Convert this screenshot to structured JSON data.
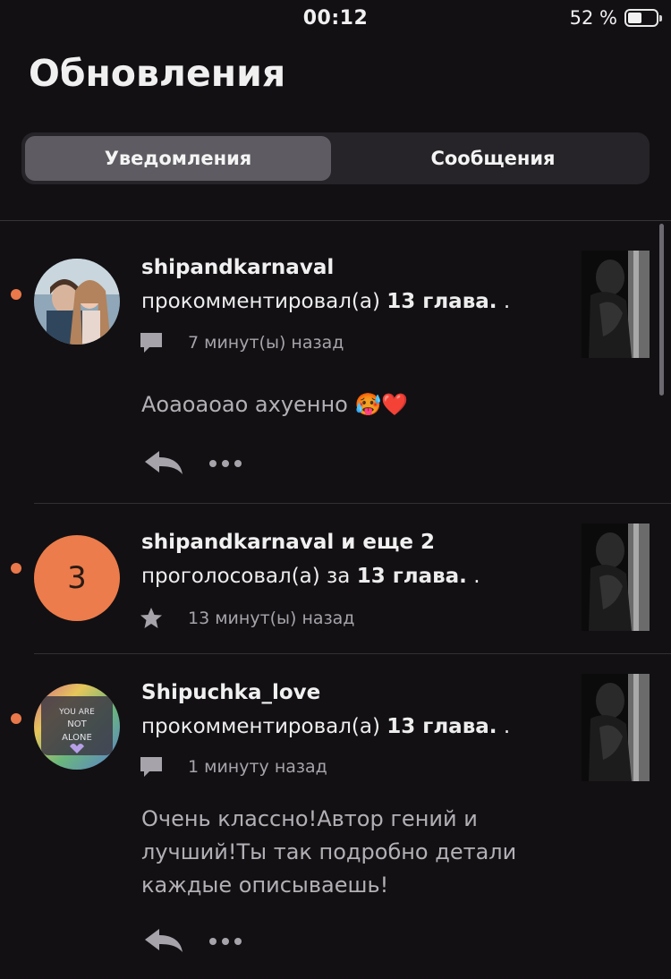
{
  "status_bar": {
    "time": "00:12",
    "battery": "52 %"
  },
  "header": {
    "title": "Обновления"
  },
  "tabs": [
    {
      "label": "Уведомления",
      "active": true
    },
    {
      "label": "Сообщения",
      "active": false
    }
  ],
  "notifications": [
    {
      "username": "shipandkarnaval",
      "action": "прокомментировал(а)",
      "target": "13 глава.",
      "suffix": " .",
      "time": "7 минут(ы) назад",
      "comment": "Аоаоаоао ахуенно 🥵❤️",
      "icon": "comment-icon",
      "unread": true
    },
    {
      "username": "shipandkarnaval и еще 2",
      "avatar_count": "3",
      "action": "проголосовал(а) за",
      "target": "13 глава.",
      "suffix": " .",
      "time": "13 минут(ы) назад",
      "icon": "star-icon",
      "unread": true
    },
    {
      "username": "Shipuchka_love",
      "avatar_text": "YOU ARE NOT ALONE",
      "action": "прокомментировал(а)",
      "target": "13 глава.",
      "suffix": " .",
      "time": "1 минуту назад",
      "comment": "Очень классно!Автор гений и лучший!Ты так подробно детали каждые описываешь!",
      "icon": "comment-icon",
      "unread": true
    }
  ],
  "colors": {
    "background": "#121013",
    "accent": "#ec7c4b",
    "segment_active": "#5e5c62",
    "muted_text": "#a6a4aa"
  }
}
